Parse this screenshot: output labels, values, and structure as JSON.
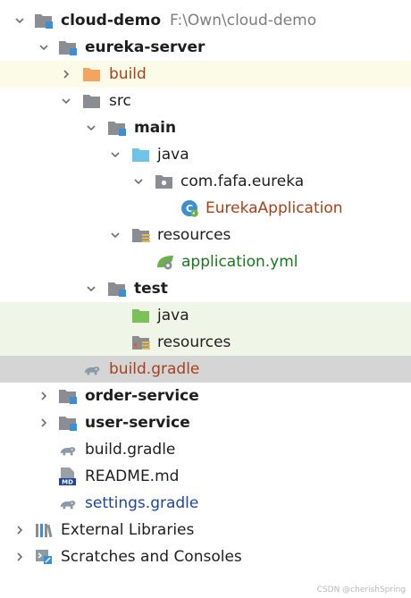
{
  "project_tree": {
    "root": {
      "name": "cloud-demo",
      "path": "F:\\Own\\cloud-demo"
    },
    "eureka_server": {
      "name": "eureka-server",
      "build_dir": "build",
      "src": "src",
      "main": "main",
      "main_java": "java",
      "package": "com.fafa.eureka",
      "app_class": "EurekaApplication",
      "main_resources": "resources",
      "yml": "application.yml",
      "test": "test",
      "test_java": "java",
      "test_resources": "resources",
      "build_gradle": "build.gradle"
    },
    "order_service": "order-service",
    "user_service": "user-service",
    "root_build_gradle": "build.gradle",
    "readme": "README.md",
    "settings_gradle": "settings.gradle",
    "external_libraries": "External Libraries",
    "scratches": "Scratches and Consoles"
  },
  "watermark": "CSDN @cherishSpring",
  "colors": {
    "selected_row": "#d5d5d5",
    "excluded_row": "#fcfbe8",
    "test_row": "#eff6e7",
    "module_blue": "#3d8fd4",
    "folder_gray": "#8a8e93",
    "source_blue": "#6ec4e8",
    "test_green": "#7cc05a",
    "excluded_orange": "#f4a460"
  }
}
